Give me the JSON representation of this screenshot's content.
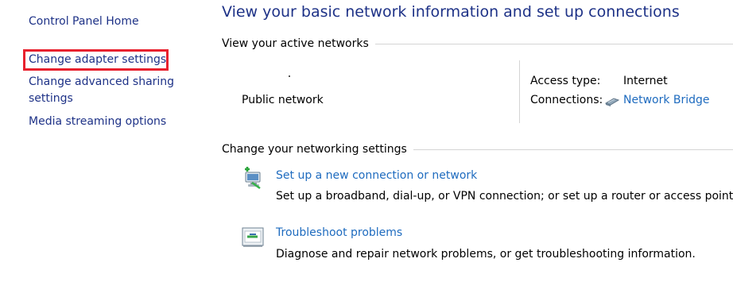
{
  "sidebar": {
    "home": "Control Panel Home",
    "adapter": "Change adapter settings",
    "advanced_line1": "Change advanced sharing",
    "advanced_line2": "settings",
    "media": "Media streaming options"
  },
  "main": {
    "title": "View your basic network information and set up connections",
    "active_section": "View your active networks",
    "network": {
      "name": ".",
      "type": "Public network",
      "access_type_label": "Access type:",
      "access_type_value": "Internet",
      "connections_label": "Connections:",
      "connections_value": "Network Bridge",
      "connections_icon": "network-bridge-icon"
    },
    "settings_section": "Change your networking settings",
    "tasks": [
      {
        "icon": "new-connection-icon",
        "link": "Set up a new connection or network",
        "desc": "Set up a broadband, dial-up, or VPN connection; or set up a router or access point."
      },
      {
        "icon": "troubleshoot-icon",
        "link": "Troubleshoot problems",
        "desc": "Diagnose and repair network problems, or get troubleshooting information."
      }
    ]
  },
  "colors": {
    "link": "#1e6bbf",
    "sidebar_link": "#1e3287",
    "highlight_border": "#e8212e"
  }
}
